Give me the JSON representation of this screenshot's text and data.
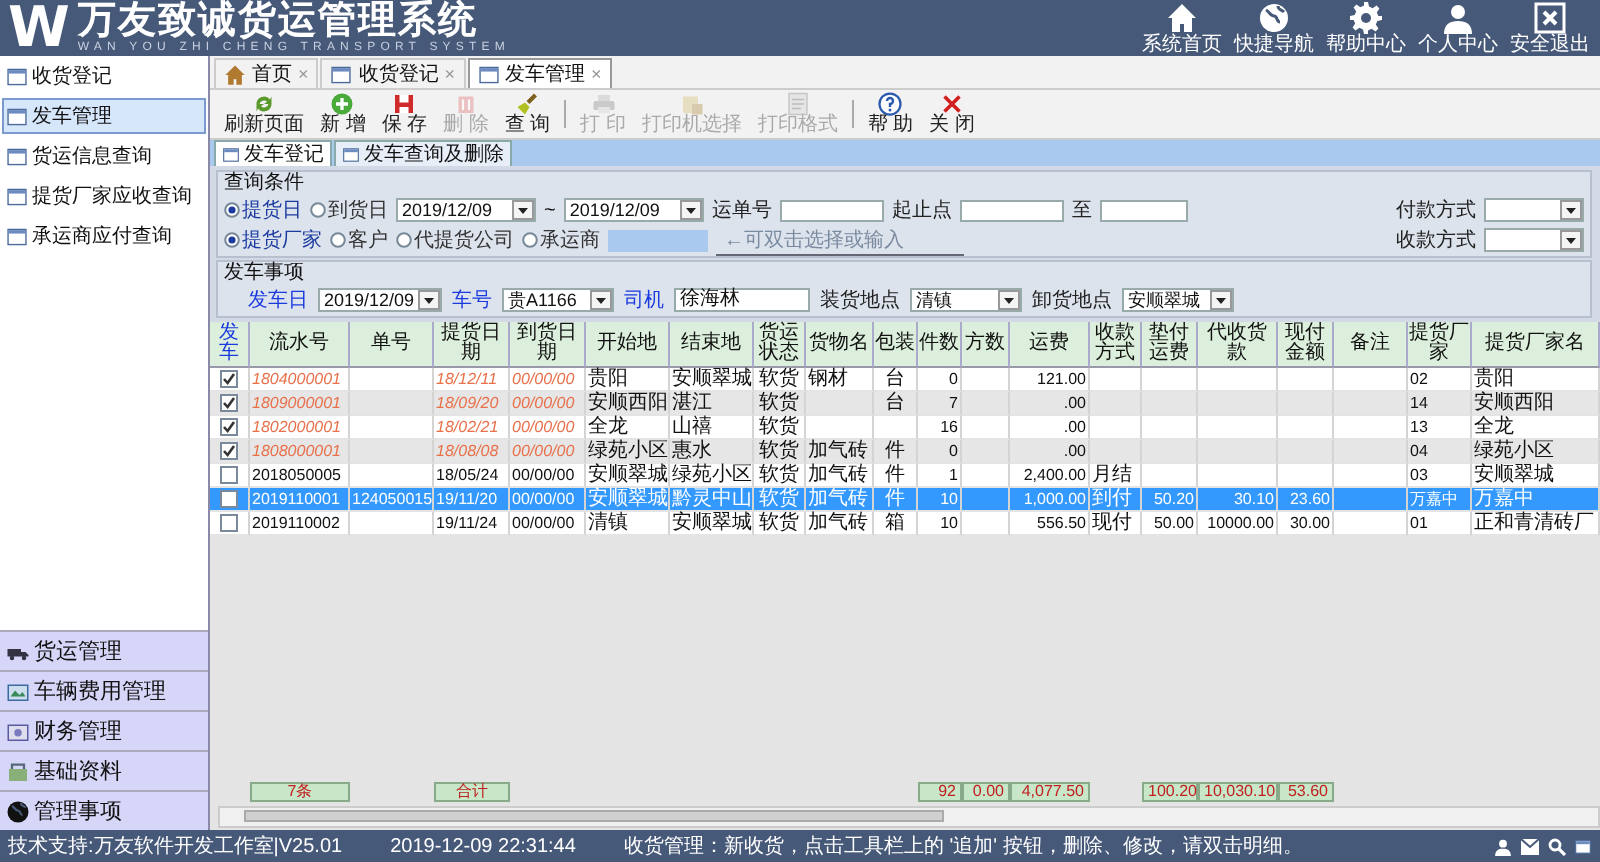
{
  "header": {
    "logo": "W",
    "title": "万友致诚货运管理系统",
    "subtitle": "WAN YOU ZHI CHENG TRANSPORT SYSTEM",
    "links": [
      {
        "kind": "home",
        "label": "系统首页"
      },
      {
        "kind": "globe",
        "label": "快捷导航"
      },
      {
        "kind": "gear",
        "label": "帮助中心"
      },
      {
        "kind": "person",
        "label": "个人中心"
      },
      {
        "kind": "exit",
        "label": "安全退出"
      }
    ]
  },
  "sidebar": {
    "items": [
      {
        "label": "收货登记",
        "selected": false
      },
      {
        "label": "发车管理",
        "selected": true
      },
      {
        "label": "货运信息查询",
        "selected": false
      },
      {
        "label": "提货厂家应收查询",
        "selected": false
      },
      {
        "label": "承运商应付查询",
        "selected": false
      }
    ],
    "sections": [
      {
        "kind": "truck",
        "label": "货运管理"
      },
      {
        "kind": "car",
        "label": "车辆费用管理"
      },
      {
        "kind": "money",
        "label": "财务管理"
      },
      {
        "kind": "data",
        "label": "基础资料"
      },
      {
        "kind": "globe",
        "label": "管理事项"
      }
    ]
  },
  "tabs": [
    {
      "kind": "home",
      "label": "首页",
      "close": "×",
      "selected": false
    },
    {
      "kind": "page",
      "label": "收货登记",
      "close": "×",
      "selected": false
    },
    {
      "kind": "page",
      "label": "发车管理",
      "close": "×",
      "selected": true
    }
  ],
  "toolbar": [
    {
      "kind": "refresh",
      "label": "刷新页面",
      "disabled": false
    },
    {
      "kind": "add",
      "label": "新 增",
      "disabled": false
    },
    {
      "kind": "save",
      "label": "保 存",
      "disabled": false
    },
    {
      "kind": "delete",
      "label": "删 除",
      "disabled": true
    },
    {
      "kind": "query",
      "label": "查 询",
      "disabled": false
    },
    {
      "kind": "print",
      "label": "打 印",
      "disabled": true
    },
    {
      "kind": "printer",
      "label": "打印机选择",
      "disabled": true
    },
    {
      "kind": "format",
      "label": "打印格式",
      "disabled": true
    },
    {
      "kind": "help",
      "label": "帮 助",
      "disabled": false
    },
    {
      "kind": "close",
      "label": "关 闭",
      "disabled": false
    }
  ],
  "subtabs": [
    {
      "label": "发车登记",
      "selected": true
    },
    {
      "label": "发车查询及删除",
      "selected": false
    }
  ],
  "query": {
    "title": "查询条件",
    "date_options": [
      {
        "label": "提货日",
        "selected": true
      },
      {
        "label": "到货日",
        "selected": false
      }
    ],
    "date_from": "2019/12/09",
    "range_sep": "~",
    "date_to": "2019/12/09",
    "fields": [
      {
        "label": "运单号"
      },
      {
        "label": "起止点"
      },
      {
        "label": "至"
      }
    ],
    "pay_method": {
      "label": "付款方式"
    },
    "party_options": [
      {
        "label": "提货厂家",
        "selected": true
      },
      {
        "label": "客户",
        "selected": false
      },
      {
        "label": "代提货公司",
        "selected": false
      },
      {
        "label": "承运商",
        "selected": false
      }
    ],
    "party_hint": "←可双击选择或输入",
    "receive_method": {
      "label": "收款方式"
    }
  },
  "dispatch": {
    "title": "发车事项",
    "fields": [
      {
        "label": "发车日",
        "value": "2019/12/09",
        "kind": "select",
        "emphasized": true
      },
      {
        "label": "车号",
        "value": "贵A1166",
        "kind": "select",
        "emphasized": true
      },
      {
        "label": "司机",
        "value": "徐海林",
        "kind": "text",
        "emphasized": true
      },
      {
        "label": "装货地点",
        "value": "清镇",
        "kind": "select",
        "emphasized": false
      },
      {
        "label": "卸货地点",
        "value": "安顺翠城",
        "kind": "select",
        "emphasized": false
      }
    ]
  },
  "table": {
    "columns": [
      {
        "label": "发车"
      },
      {
        "label": "流水号",
        "total": "7条"
      },
      {
        "label": "单号"
      },
      {
        "label": "提货日期",
        "total": "合计"
      },
      {
        "label": "到货日期"
      },
      {
        "label": "开始地"
      },
      {
        "label": "结束地"
      },
      {
        "label": "货运状态"
      },
      {
        "label": "货物名"
      },
      {
        "label": "包装"
      },
      {
        "label": "件数",
        "total": "92"
      },
      {
        "label": "方数",
        "total": "0.00"
      },
      {
        "label": "运费",
        "total": "4,077.50"
      },
      {
        "label": "收款方式"
      },
      {
        "label": "垫付运费",
        "total": "100.20"
      },
      {
        "label": "代收货款",
        "total": "10,030.10"
      },
      {
        "label": "现付金额",
        "total": "53.60"
      },
      {
        "label": "备注"
      },
      {
        "label": "提货厂家"
      },
      {
        "label": "提货厂家名"
      }
    ],
    "rows": [
      {
        "checked": true,
        "selected": false,
        "dispatched": true,
        "cells": [
          "",
          "1804000001",
          "",
          "18/12/11",
          "00/00/00",
          "贵阳",
          "安顺翠城",
          "软货",
          "钢材",
          "台",
          "0",
          "",
          "121.00",
          "",
          "",
          "",
          "",
          "",
          "02",
          "贵阳"
        ]
      },
      {
        "checked": true,
        "selected": false,
        "dispatched": true,
        "cells": [
          "",
          "1809000001",
          "",
          "18/09/20",
          "00/00/00",
          "安顺西阳",
          "湛江",
          "软货",
          "",
          "台",
          "7",
          "",
          ".00",
          "",
          "",
          "",
          "",
          "",
          "14",
          "安顺西阳"
        ]
      },
      {
        "checked": true,
        "selected": false,
        "dispatched": true,
        "cells": [
          "",
          "1802000001",
          "",
          "18/02/21",
          "00/00/00",
          "全龙",
          "山禧",
          "软货",
          "",
          "",
          "16",
          "",
          ".00",
          "",
          "",
          "",
          "",
          "",
          "13",
          "全龙"
        ]
      },
      {
        "checked": true,
        "selected": false,
        "dispatched": true,
        "cells": [
          "",
          "1808000001",
          "",
          "18/08/08",
          "00/00/00",
          "绿苑小区",
          "惠水",
          "软货",
          "加气砖",
          "件",
          "0",
          "",
          ".00",
          "",
          "",
          "",
          "",
          "",
          "04",
          "绿苑小区"
        ]
      },
      {
        "checked": false,
        "selected": false,
        "dispatched": false,
        "cells": [
          "",
          "2018050005",
          "",
          "18/05/24",
          "00/00/00",
          "安顺翠城",
          "绿苑小区",
          "软货",
          "加气砖",
          "件",
          "1",
          "",
          "2,400.00",
          "月结",
          "",
          "",
          "",
          "",
          "03",
          "安顺翠城"
        ]
      },
      {
        "checked": false,
        "selected": true,
        "dispatched": false,
        "cells": [
          "",
          "2019110001",
          "124050015",
          "19/11/20",
          "00/00/00",
          "安顺翠城",
          "黔灵中山",
          "软货",
          "加气砖",
          "件",
          "10",
          "",
          "1,000.00",
          "到付",
          "50.20",
          "30.10",
          "23.60",
          "",
          "万嘉中",
          "万嘉中"
        ]
      },
      {
        "checked": false,
        "selected": false,
        "dispatched": false,
        "cells": [
          "",
          "2019110002",
          "",
          "19/11/24",
          "00/00/00",
          "清镇",
          "安顺翠城",
          "软货",
          "加气砖",
          "箱",
          "10",
          "",
          "556.50",
          "现付",
          "50.00",
          "10000.00",
          "30.00",
          "",
          "01",
          "正和青清砖厂"
        ]
      }
    ]
  },
  "status_bar": {
    "support": "技术支持:万友软件开发工作室|V25.01",
    "time": "2019-12-09 22:31:44",
    "message": "收货管理：新收货，点击工具栏上的 '追加' 按钮，删除、修改，请双击明细。"
  }
}
